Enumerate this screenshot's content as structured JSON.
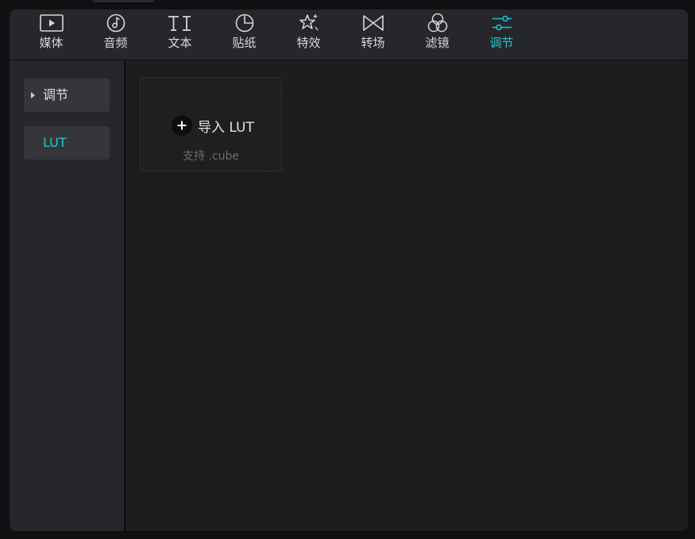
{
  "toolbar": {
    "active_color": "#1fc6d2",
    "tabs": [
      {
        "label": "媒体",
        "icon": "media-play-icon"
      },
      {
        "label": "音频",
        "icon": "music-note-icon"
      },
      {
        "label": "文本",
        "icon": "text-ti-icon"
      },
      {
        "label": "贴纸",
        "icon": "sticker-icon"
      },
      {
        "label": "特效",
        "icon": "sparkle-star-icon"
      },
      {
        "label": "转场",
        "icon": "transition-bowtie-icon"
      },
      {
        "label": "滤镜",
        "icon": "filter-circles-icon"
      },
      {
        "label": "调节",
        "icon": "sliders-icon",
        "active": true
      }
    ]
  },
  "sidebar": {
    "items": [
      {
        "label": "调节",
        "icon": "caret-right-icon"
      },
      {
        "label": "LUT",
        "selected": true
      }
    ]
  },
  "main": {
    "import_card": {
      "icon": "plus-circle-icon",
      "label": "导入 LUT",
      "hint": "支持 .cube"
    }
  }
}
